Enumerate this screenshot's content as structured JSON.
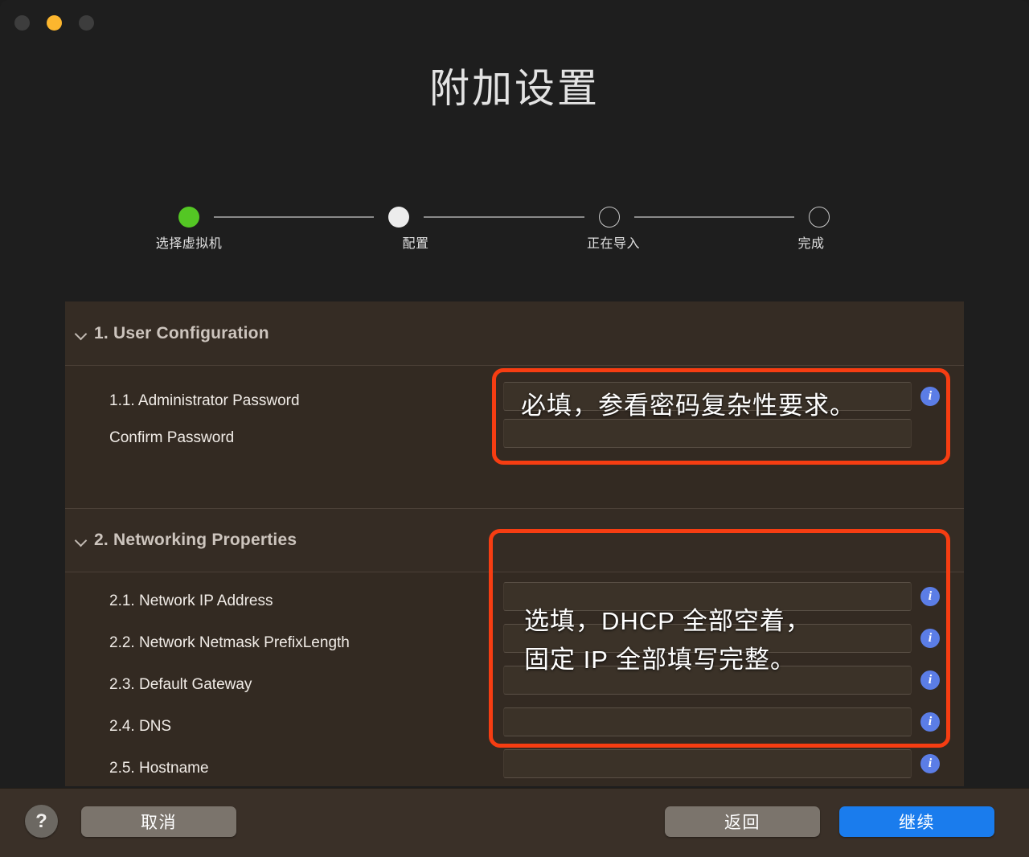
{
  "window": {
    "title": "附加设置",
    "traffic_lights": [
      "close",
      "minimize",
      "maximize"
    ]
  },
  "stepper": {
    "steps": [
      {
        "label": "选择虚拟机",
        "state": "done"
      },
      {
        "label": "配置",
        "state": "current"
      },
      {
        "label": "正在导入",
        "state": "todo"
      },
      {
        "label": "完成",
        "state": "todo"
      }
    ]
  },
  "sections": [
    {
      "number_title": "1. User Configuration",
      "rows": [
        {
          "label": "1.1. Administrator Password"
        },
        {
          "label": "Confirm Password"
        }
      ],
      "annotation": "必填，参看密码复杂性要求。"
    },
    {
      "number_title": "2. Networking Properties",
      "rows": [
        {
          "label": "2.1. Network IP Address"
        },
        {
          "label": "2.2. Network Netmask PrefixLength"
        },
        {
          "label": "2.3. Default Gateway"
        },
        {
          "label": "2.4. DNS"
        },
        {
          "label": "2.5. Hostname"
        }
      ],
      "annotation_line1": "选填，DHCP 全部空着，",
      "annotation_line2": "固定 IP 全部填写完整。"
    }
  ],
  "footer": {
    "help_label": "?",
    "cancel_label": "取消",
    "back_label": "返回",
    "next_label": "继续"
  },
  "icons": {
    "info": "i",
    "chevron_down": "chevron-down-icon"
  },
  "colors": {
    "accent_blue": "#1a7ced",
    "info_blue": "#5b7de6",
    "annotation_red": "#f63d12",
    "step_done_green": "#54c724",
    "panel_bg": "#332a22",
    "window_bg": "#1e1e1e"
  }
}
